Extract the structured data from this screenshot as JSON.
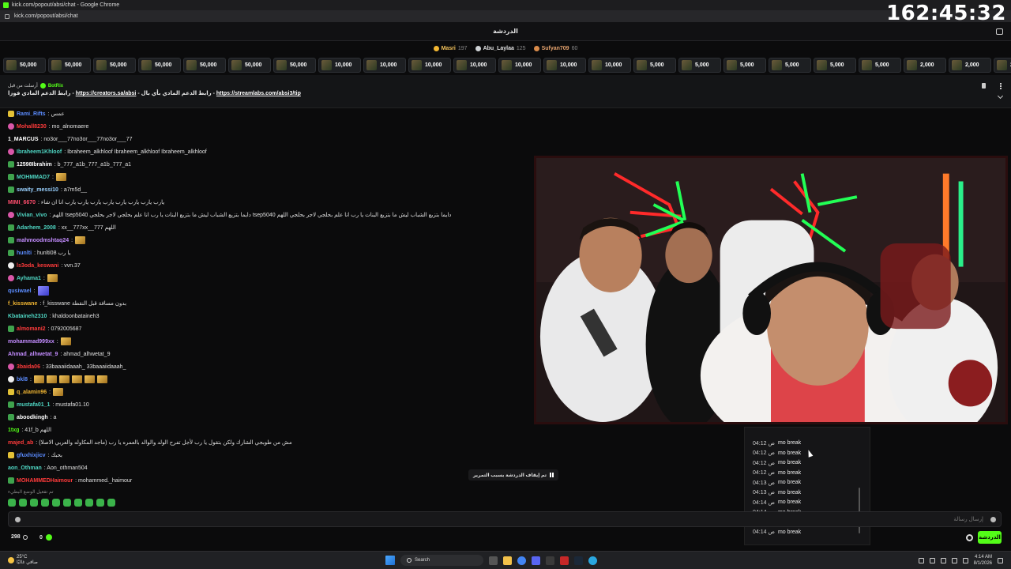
{
  "window": {
    "title": "kick.com/popout/absi/chat - Google Chrome",
    "url": "kick.com/popout/absi/chat"
  },
  "overlay_clock": "162:45:32",
  "header": {
    "title": "الدردشة"
  },
  "leaders": [
    {
      "name": "Masri",
      "count": "197"
    },
    {
      "name": "Abu_Laylaa",
      "count": "125"
    },
    {
      "name": "Sufyan709",
      "count": "60"
    }
  ],
  "gifts": [
    "50,000",
    "50,000",
    "50,000",
    "50,000",
    "50,000",
    "50,000",
    "50,000",
    "10,000",
    "10,000",
    "10,000",
    "10,000",
    "10,000",
    "10,000",
    "10,000",
    "5,000",
    "5,000",
    "5,000",
    "5,000",
    "5,000",
    "5,000",
    "2,000",
    "2,000",
    "2,000"
  ],
  "pinned": {
    "author_prefix": "أرسلت من قبل",
    "author": "BotRix",
    "text_a": "رابط الدعم المادي فوزا - ",
    "link_a": "https://creators.sa/absi",
    "text_b": " - رابط الدعم المادي بأي بال - ",
    "link_b": "https://streamlabs.com/absi3/tip"
  },
  "messages": [
    {
      "user": "Rami_Rifts",
      "color": "#5b8cff",
      "badge": "b-yellow",
      "text": ": عمس",
      "emote": ""
    },
    {
      "user": "Mohall8230",
      "color": "#ff3b3b",
      "badge": "b-pink",
      "text": ": mo_alnomaere",
      "emote": ""
    },
    {
      "user": "1_MARCUS",
      "color": "#ffffff",
      "badge": "",
      "text": ": no3or___77no3or___77no3or___77",
      "emote": ""
    },
    {
      "user": "Ibraheem1Khloof",
      "color": "#4fd6c3",
      "badge": "b-pink",
      "text": ": Ibraheem_alkhloof Ibraheem_alkhloof Ibraheem_alkhloof",
      "emote": ""
    },
    {
      "user": "12598Ibrahim",
      "color": "#ffffff",
      "badge": "b-green",
      "text": ": b_777_a1b_777_a1b_777_a1",
      "emote": ""
    },
    {
      "user": "MOHMMAD7",
      "color": "#4fd6c3",
      "badge": "b-green",
      "text": ":",
      "emote": "gold"
    },
    {
      "user": "swaity_messi10",
      "color": "#9ad1ff",
      "badge": "b-green",
      "text": ": a7m5d__",
      "emote": ""
    },
    {
      "user": "MIMI_6670",
      "color": "#ff4d6d",
      "badge": "",
      "text": ": يارب يارب يارب يارب يارب يارب يارب يارب انا ان شاء",
      "emote": ""
    },
    {
      "user": "Vivian_vivo",
      "color": "#4fd6c3",
      "badge": "b-pink",
      "text": ": اللهم tsep5040 دايما بتزيع الشباب ليش ما بتزيع البنات يا رب انا علم بحلجي لاجر بحلجي tsep5040 دايما بتزيع الشباب ليش ما بتزيع البنات يا رب انا علم بحلجي لاجر بحلجي اللهم",
      "emote": ""
    },
    {
      "user": "Adarhem_2008",
      "color": "#4fd6c3",
      "badge": "b-green",
      "text": ": xx__777xx__777 اللهم",
      "emote": ""
    },
    {
      "user": "mahmoodmshtaq24",
      "color": "#c38cff",
      "badge": "b-green",
      "text": ":",
      "emote": "gold"
    },
    {
      "user": "hunlti",
      "color": "#5b8cff",
      "badge": "b-green",
      "text": ": hunlti08 يا رب",
      "emote": ""
    },
    {
      "user": "ls3oda_keswani",
      "color": "#ff3b3b",
      "badge": "b-white",
      "text": ": vvn.37",
      "emote": ""
    },
    {
      "user": "Ayhama1",
      "color": "#4fd6c3",
      "badge": "b-pink",
      "text": ":",
      "emote": "gold"
    },
    {
      "user": "qusiwael",
      "color": "#5b8cff",
      "badge": "",
      "text": ":",
      "emote": "purple"
    },
    {
      "user": "f_kisswane",
      "color": "#f2b632",
      "badge": "",
      "text": ": f_kisswane بدون مسافة قبل النقطة",
      "emote": ""
    },
    {
      "user": "Kbataineh2310",
      "color": "#4fd6c3",
      "badge": "",
      "text": ": khaldoonbataineh3",
      "emote": ""
    },
    {
      "user": "almomani2",
      "color": "#ff3b3b",
      "badge": "b-green",
      "text": ": 0792005687",
      "emote": ""
    },
    {
      "user": "mohammad999xx",
      "color": "#c38cff",
      "badge": "",
      "text": ":",
      "emote": "gold"
    },
    {
      "user": "Ahmad_alhwetat_9",
      "color": "#c38cff",
      "badge": "",
      "text": ": ahmad_alhwetat_9",
      "emote": ""
    },
    {
      "user": "3baida06",
      "color": "#ff3b3b",
      "badge": "b-pink",
      "text": ": 33baaaiidaaah_ 33baaaiidaaah_",
      "emote": ""
    },
    {
      "user": "bkl8",
      "color": "#5b8cff",
      "badge": "b-white",
      "text": ":",
      "emote": "gold6"
    },
    {
      "user": "q_alamin96",
      "color": "#f2b632",
      "badge": "b-yellow",
      "text": ":",
      "emote": "gold"
    },
    {
      "user": "mustafa01_1",
      "color": "#4fd6c3",
      "badge": "b-green",
      "text": ": mustafa01.10",
      "emote": ""
    },
    {
      "user": "aboodkingh",
      "color": "#ffffff",
      "badge": "b-green",
      "text": ": a",
      "emote": ""
    },
    {
      "user": "1txg",
      "color": "#53fc18",
      "badge": "",
      "text": ": 41f_b اللهم",
      "emote": ""
    },
    {
      "user": "majed_ab",
      "color": "#ff3b3b",
      "badge": "",
      "text": ": مش من طوبجي الشارك ولكن بتقول يا رب لأجل تفرح الولد والوالد بالعمره يا رب (ماجد المكاوله والعربي الاصلا)",
      "emote": ""
    },
    {
      "user": "gfuxhixjicv",
      "color": "#5b8cff",
      "badge": "b-yellow",
      "text": ": بحبك",
      "emote": ""
    },
    {
      "user": "aon_Othman",
      "color": "#4fd6c3",
      "badge": "",
      "text": ": Aon_othman504",
      "emote": ""
    },
    {
      "user": "MOHAMMEDHaimour",
      "color": "#ff3b3b",
      "badge": "b-green",
      "text": ": mohammed._haimour",
      "emote": ""
    }
  ],
  "chat_notice": "تم تفعيل الوضع البطيء",
  "chat_paused": "تم إيقاف الدردشة بسبب التمرير",
  "popup_rows": [
    {
      "time": "04:12 ص",
      "text": "mo break"
    },
    {
      "time": "04:12 ص",
      "text": "mo break"
    },
    {
      "time": "04:12 ص",
      "text": "mo break"
    },
    {
      "time": "04:12 ص",
      "text": "mo break"
    },
    {
      "time": "04:13 ص",
      "text": "mo break"
    },
    {
      "time": "04:13 ص",
      "text": "mo break"
    },
    {
      "time": "04:14 ص",
      "text": "mo break"
    },
    {
      "time": "04:14 ص",
      "text": "mo break"
    },
    {
      "time": "04:14 ص",
      "text": "mo break"
    },
    {
      "time": "04:14 ص",
      "text": "mo break"
    }
  ],
  "input": {
    "placeholder": "إرسال رسالة"
  },
  "bottom": {
    "viewers": "298",
    "points": "0",
    "chat_button": "الدردشة"
  },
  "taskbar": {
    "weather_temp": "25°C",
    "weather_desc": "صافي غالبًا",
    "search": "Search",
    "time": "4:14 AM",
    "date": "8/1/2026"
  },
  "colors": {
    "accent": "#53fc18",
    "background": "#0b0b0c"
  }
}
